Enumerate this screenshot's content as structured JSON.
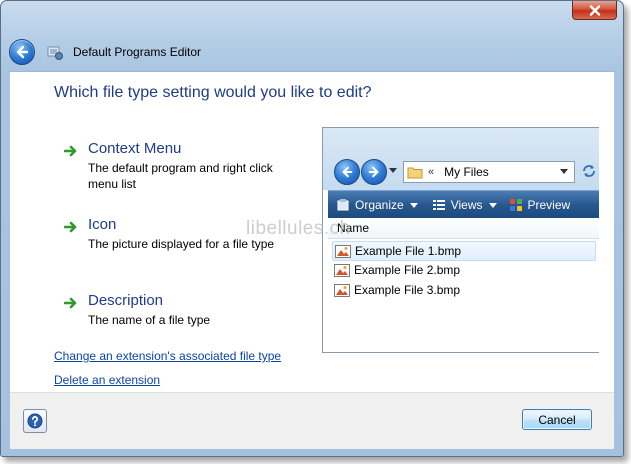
{
  "window": {
    "title": "Default Programs Editor"
  },
  "question": "Which file type setting would you like to edit?",
  "options": [
    {
      "title": "Context Menu",
      "description": "The default program and right click menu list"
    },
    {
      "title": "Icon",
      "description": "The picture displayed for a file type"
    },
    {
      "title": "Description",
      "description": "The name of a file type"
    }
  ],
  "links": {
    "change_extension": "Change an extension's associated file type",
    "delete_extension": "Delete an extension"
  },
  "preview": {
    "address_chevron": "«",
    "address": "My Files",
    "toolbar": {
      "organize": "Organize",
      "views": "Views",
      "preview": "Preview"
    },
    "column_header": "Name",
    "files": [
      "Example File 1.bmp",
      "Example File 2.bmp",
      "Example File 3.bmp"
    ]
  },
  "watermark": "libellules.ch",
  "footer": {
    "cancel_label": "Cancel"
  },
  "colors": {
    "heading_blue": "#1f3b8a",
    "link_blue": "#0b44a8",
    "arrow_green": "#2e9a2e",
    "toolbar_blue": "#27578e"
  }
}
